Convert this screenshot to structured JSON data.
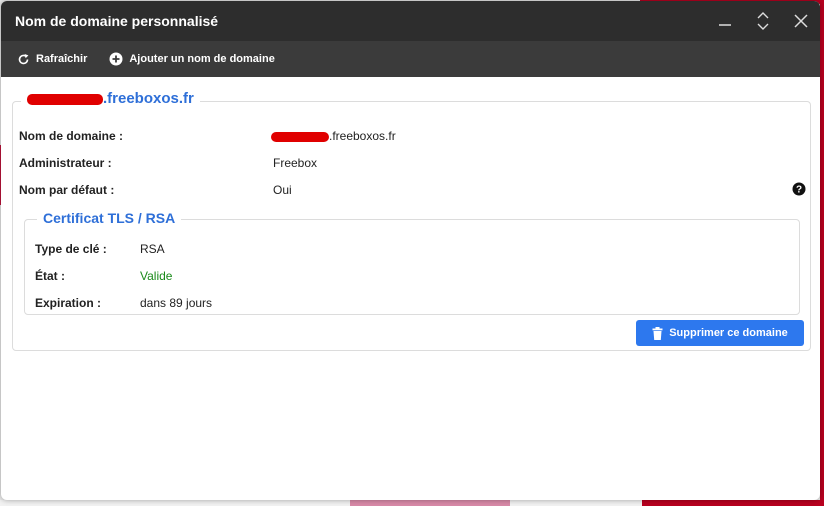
{
  "window": {
    "title": "Nom de domaine personnalisé"
  },
  "toolbar": {
    "refresh_label": "Rafraîchir",
    "add_domain_label": "Ajouter un nom de domaine"
  },
  "domain": {
    "legend_suffix": ".freeboxos.fr",
    "fields": [
      {
        "label": "Nom de domaine :",
        "value": ".freeboxos.fr"
      },
      {
        "label": "Administrateur :",
        "value": "Freebox"
      },
      {
        "label": "Nom par défaut :",
        "value": "Oui"
      }
    ]
  },
  "certificate": {
    "legend": "Certificat TLS / RSA",
    "fields": [
      {
        "label": "Type de clé :",
        "value": "RSA"
      },
      {
        "label": "État :",
        "value": "Valide"
      },
      {
        "label": "Expiration :",
        "value": "dans 89 jours"
      }
    ]
  },
  "actions": {
    "delete_label": "Supprimer ce domaine"
  },
  "colors": {
    "accent": "#2e6fd8",
    "button": "#2d78ee",
    "valid": "#1a8a1a",
    "titlebar": "#2d2d2d",
    "toolbar": "#3b3b3b",
    "redaction": "#e00000"
  }
}
